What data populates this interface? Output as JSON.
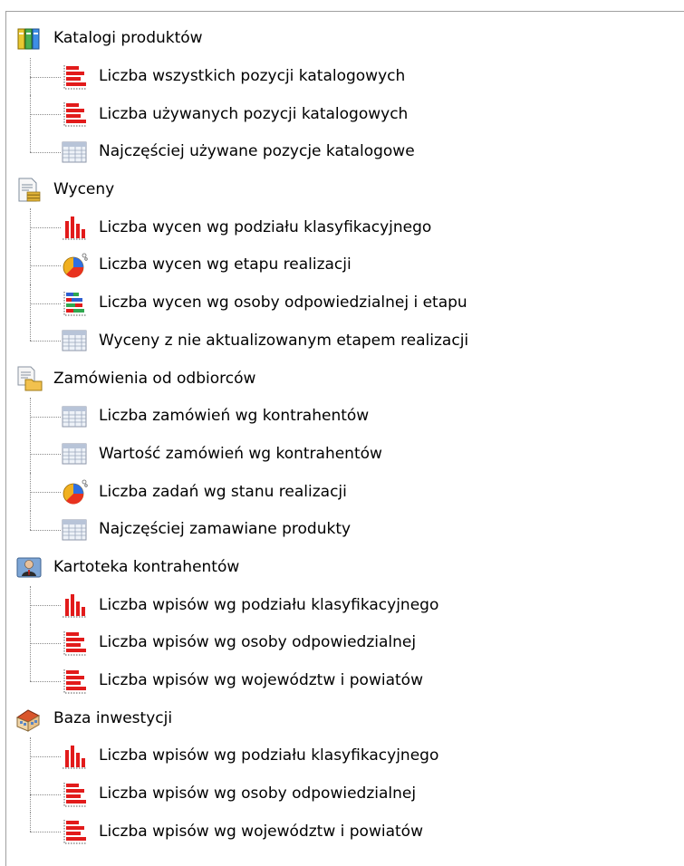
{
  "tree": [
    {
      "label": "Katalogi produktów",
      "icon": "books-icon",
      "children": [
        {
          "label": "Liczba wszystkich pozycji katalogowych",
          "icon": "bar-chart-horizontal-icon"
        },
        {
          "label": "Liczba używanych pozycji katalogowych",
          "icon": "bar-chart-horizontal-icon"
        },
        {
          "label": "Najczęściej używane pozycje katalogowe",
          "icon": "table-icon"
        }
      ]
    },
    {
      "label": "Wyceny",
      "icon": "document-money-icon",
      "children": [
        {
          "label": "Liczba wycen wg podziału klasyfikacyjnego",
          "icon": "bar-chart-vertical-icon"
        },
        {
          "label": "Liczba wycen wg etapu realizacji",
          "icon": "pie-chart-icon"
        },
        {
          "label": "Liczba wycen wg osoby odpowiedzialnej i etapu",
          "icon": "bar-chart-stacked-icon"
        },
        {
          "label": "Wyceny z nie aktualizowanym etapem realizacji",
          "icon": "table-icon"
        }
      ]
    },
    {
      "label": "Zamówienia od odbiorców",
      "icon": "order-folder-icon",
      "children": [
        {
          "label": "Liczba zamówień wg kontrahentów",
          "icon": "table-icon"
        },
        {
          "label": "Wartość zamówień wg kontrahentów",
          "icon": "table-icon"
        },
        {
          "label": "Liczba zadań wg stanu realizacji",
          "icon": "pie-chart-icon"
        },
        {
          "label": "Najczęściej zamawiane produkty",
          "icon": "table-icon"
        }
      ]
    },
    {
      "label": "Kartoteka kontrahentów",
      "icon": "contact-card-icon",
      "children": [
        {
          "label": "Liczba wpisów wg podziału klasyfikacyjnego",
          "icon": "bar-chart-vertical-icon"
        },
        {
          "label": "Liczba wpisów wg osoby odpowiedzialnej",
          "icon": "bar-chart-horizontal-icon"
        },
        {
          "label": "Liczba wpisów wg województw i powiatów",
          "icon": "bar-chart-horizontal-icon"
        }
      ]
    },
    {
      "label": "Baza inwestycji",
      "icon": "building-icon",
      "children": [
        {
          "label": "Liczba wpisów wg podziału klasyfikacyjnego",
          "icon": "bar-chart-vertical-icon"
        },
        {
          "label": "Liczba wpisów wg osoby odpowiedzialnej",
          "icon": "bar-chart-horizontal-icon"
        },
        {
          "label": "Liczba wpisów wg województw i powiatów",
          "icon": "bar-chart-horizontal-icon"
        }
      ]
    }
  ]
}
